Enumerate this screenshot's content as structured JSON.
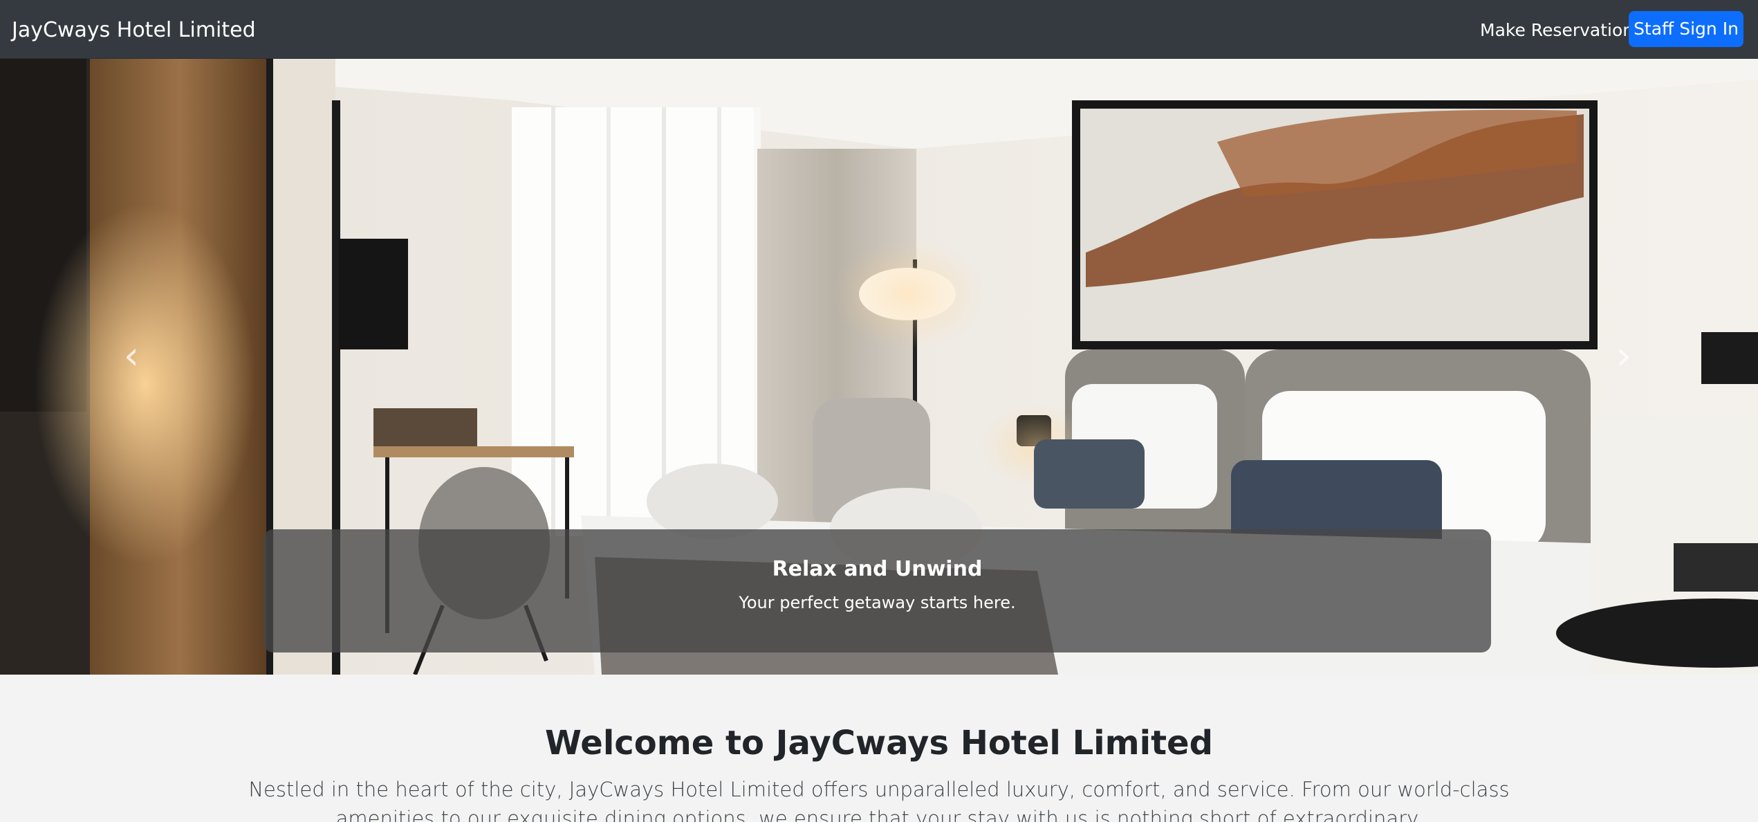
{
  "navbar": {
    "brand": "JayCways Hotel Limited",
    "reservation_link": "Make Reservation",
    "signin_button": "Staff Sign In",
    "background_color": "#343a40",
    "button_color": "#0d6efd"
  },
  "carousel": {
    "prev_icon": "chevron-left-icon",
    "next_icon": "chevron-right-icon",
    "slide": {
      "image": "hotel-room-photo",
      "caption_title": "Relax and Unwind",
      "caption_text": "Your perfect getaway starts here."
    }
  },
  "welcome": {
    "title": "Welcome to JayCways Hotel Limited",
    "text": "Nestled in the heart of the city, JayCways Hotel Limited offers unparalleled luxury, comfort, and service. From our world-class amenities to our exquisite dining options, we ensure that your stay with us is nothing short of extraordinary."
  }
}
